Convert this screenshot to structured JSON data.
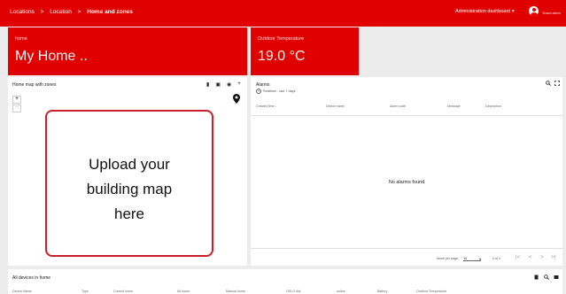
{
  "topbar": {
    "breadcrumbs": [
      "Locations",
      ">",
      "Location",
      ">",
      "Home and zones"
    ],
    "dashboard_label": "Administration dashboard ▾",
    "user_label": "Tenant admin"
  },
  "cards": {
    "home": {
      "label": "home",
      "value": "My Home .."
    },
    "temperature": {
      "label": "Outdoor Temperature",
      "value": "19.0 °C"
    }
  },
  "map": {
    "title": "Home map with zones",
    "zoom_in": "+",
    "zoom_out": "−",
    "placeholder_lines": [
      "Upload your",
      "building map",
      "here"
    ],
    "icons": [
      "book-icon",
      "image-icon",
      "pin-icon",
      "plus-icon"
    ]
  },
  "alarms": {
    "title": "Alarms",
    "timewindow": "Realtime - last 7 days",
    "columns": [
      "Created time ↓",
      "Device name",
      "Alarm code",
      "Message",
      "Description"
    ],
    "empty_text": "No alarms found",
    "items_per_page_label": "Items per page:",
    "items_per_page_value": "10",
    "range_text": "0 of 0",
    "icons": [
      "search-icon",
      "fullscreen-icon",
      "clock-icon"
    ]
  },
  "devices": {
    "title": "All devices in home",
    "columns": [
      "Device Name",
      "Type",
      "Current home",
      "Alt home",
      "Manual home",
      "OSLO link",
      "online",
      "Battery",
      "Outdoor Temperature"
    ]
  },
  "colors": {
    "accent": "#e10000",
    "upload_border": "#c8202a"
  }
}
